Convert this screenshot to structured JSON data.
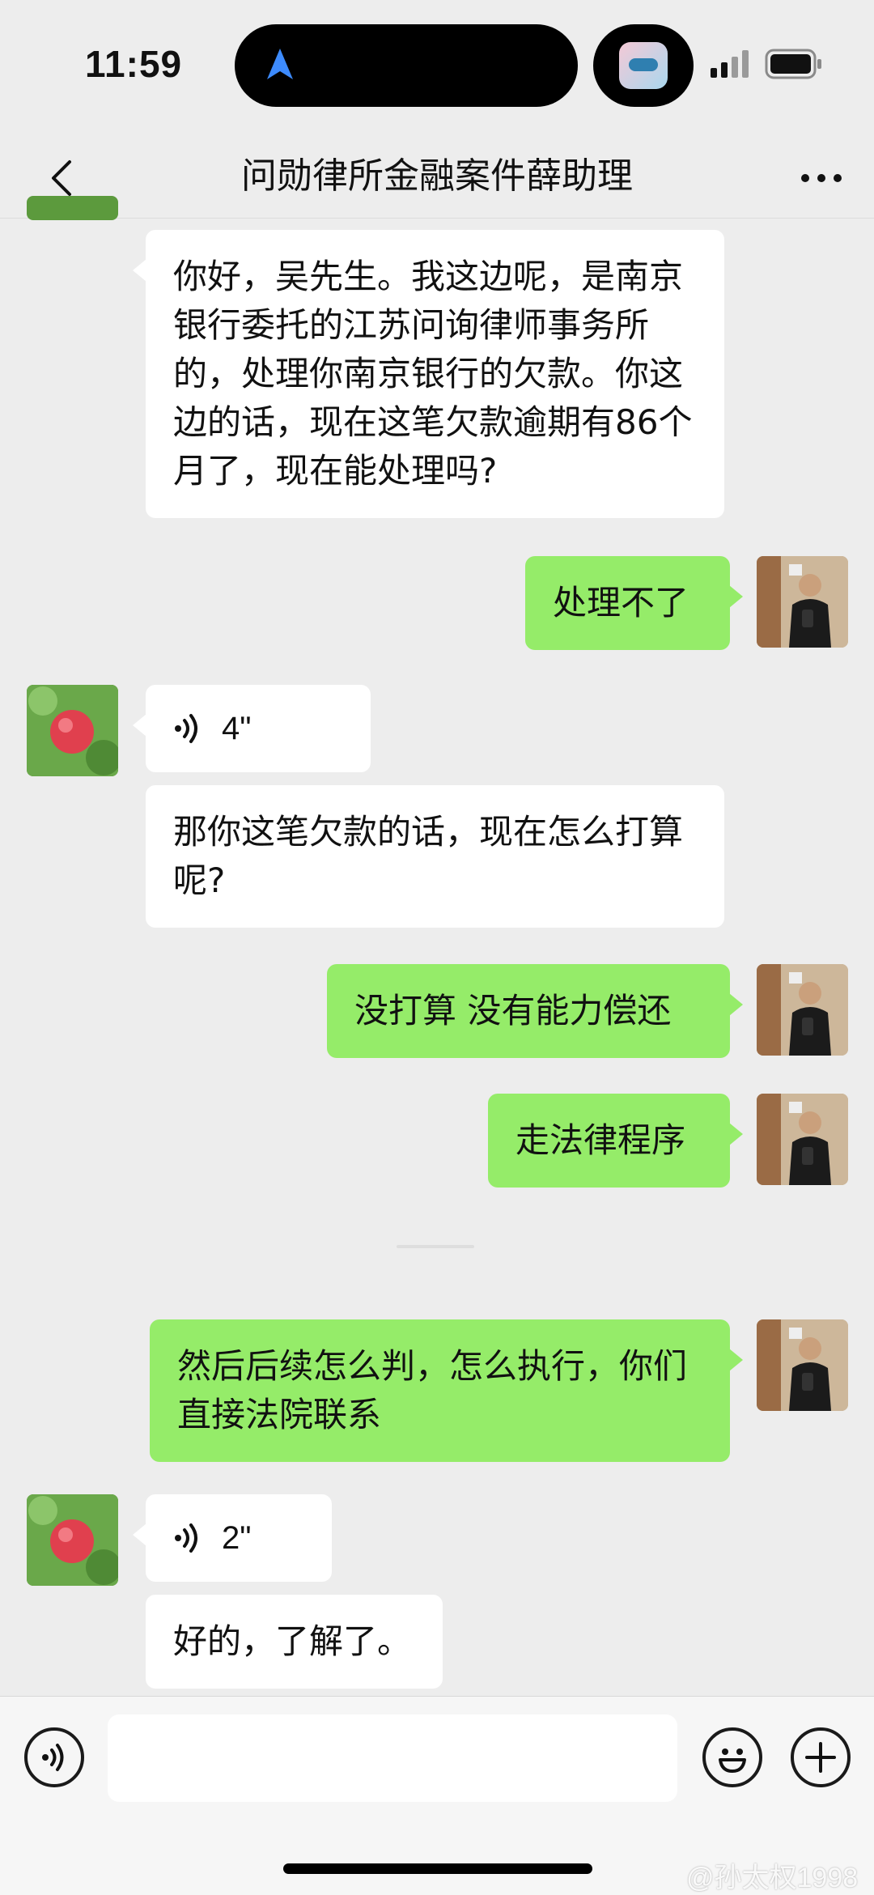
{
  "status_bar": {
    "time": "11:59"
  },
  "nav": {
    "title": "问勋律所金融案件薛助理"
  },
  "messages": {
    "m1": "你好，吴先生。我这边呢，是南京银行委托的江苏问询律师事务所的，处理你南京银行的欠款。你这边的话，现在这笔欠款逾期有86个月了，现在能处理吗?",
    "m2": "处理不了",
    "m3_voice": "4\"",
    "m4": "那你这笔欠款的话，现在怎么打算呢?",
    "m5": "没打算 没有能力偿还",
    "m6": "走法律程序",
    "m7": "然后后续怎么判，怎么执行，你们直接法院联系",
    "m8_voice": "2\"",
    "m9": "好的，了解了。"
  },
  "input": {
    "placeholder": ""
  },
  "watermark": "@孙太权1998",
  "colors": {
    "background": "#ededed",
    "self_bubble": "#95ec69",
    "other_bubble": "#ffffff"
  },
  "icons": {
    "back": "chevron-left-icon",
    "more": "more-dots-icon",
    "voice_toggle": "voice-icon",
    "emoji": "emoji-icon",
    "add": "plus-icon"
  }
}
